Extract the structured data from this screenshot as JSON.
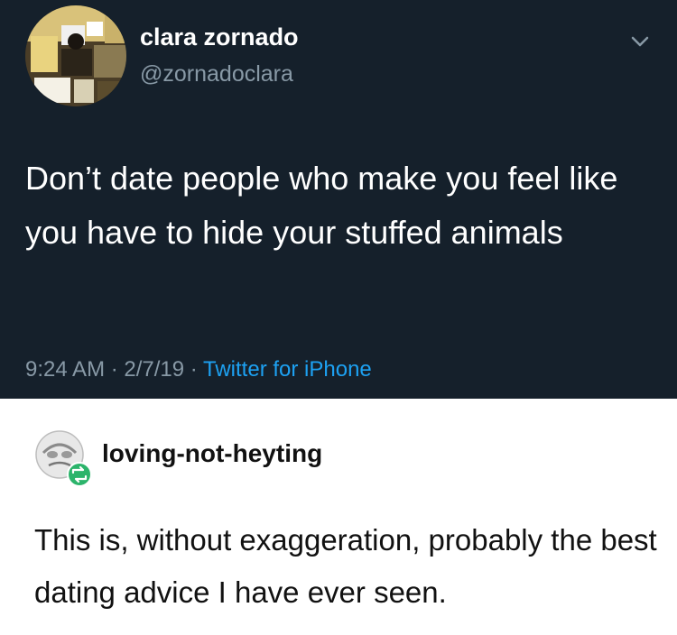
{
  "tweet": {
    "display_name": "clara zornado",
    "handle": "@zornadoclara",
    "text": "Don’t date people who make you feel like you have to hide your stuffed animals",
    "time": "9:24 AM · 2/7/19 · ",
    "source": "Twitter for iPhone",
    "icons": {
      "menu": "chevron-down-icon",
      "avatar": "profile-photo"
    }
  },
  "tumblr": {
    "username": "loving-not-heyting",
    "text": "This is, without exaggeration, probably the best dating advice I have ever seen.",
    "icons": {
      "avatar": "profile-avatar",
      "reblog": "reblog-icon"
    }
  },
  "colors": {
    "twitter_bg": "#15202b",
    "twitter_text": "#ffffff",
    "twitter_muted": "#8899a6",
    "twitter_link": "#1da1f2",
    "tumblr_bg": "#ffffff",
    "tumblr_text": "#111111",
    "reblog_green": "#2cb46b"
  }
}
